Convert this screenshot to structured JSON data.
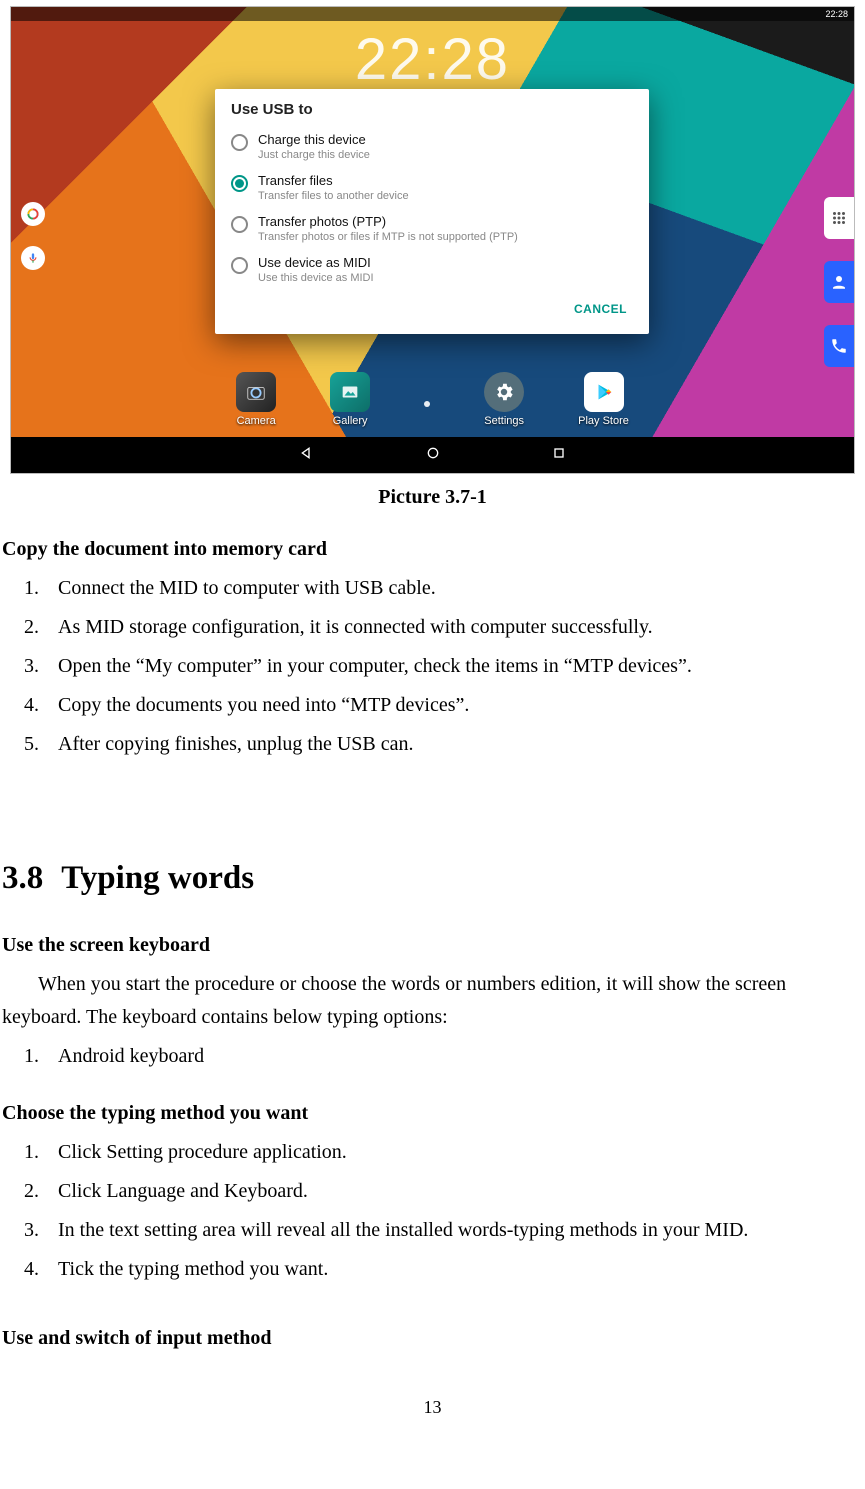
{
  "screenshot": {
    "status_time": "22:28",
    "clock_partial": "22:28",
    "dialog": {
      "title": "Use USB to",
      "options": [
        {
          "label": "Charge this device",
          "sub": "Just charge this device",
          "selected": false
        },
        {
          "label": "Transfer files",
          "sub": "Transfer files to another device",
          "selected": true
        },
        {
          "label": "Transfer photos (PTP)",
          "sub": "Transfer photos or files if MTP is not supported (PTP)",
          "selected": false
        },
        {
          "label": "Use device as MIDI",
          "sub": "Use this device as MIDI",
          "selected": false
        }
      ],
      "cancel": "CANCEL"
    },
    "apps": [
      "Camera",
      "Gallery",
      "Settings",
      "Play Store"
    ]
  },
  "caption": "Picture 3.7-1",
  "copy_heading": "Copy the document into memory card",
  "copy_steps": [
    "Connect the MID to computer with USB cable.",
    "As MID storage configuration, it is connected with computer successfully.",
    "Open the “My computer” in your computer, check the items in “MTP devices”.",
    "Copy the documents you need into “MTP devices”.",
    "After copying finishes, unplug the USB can."
  ],
  "section": {
    "num": "3.8",
    "title": "Typing words"
  },
  "use_kb_heading": "Use the screen keyboard",
  "use_kb_para": "When you start the procedure or choose the words or numbers edition, it will show the screen keyboard. The keyboard contains below typing options:",
  "kb_options": [
    "Android keyboard"
  ],
  "choose_heading": "Choose the typing method you want",
  "choose_steps": [
    "Click Setting procedure application.",
    "Click Language and Keyboard.",
    "In the text setting area will reveal all the installed words-typing methods in your MID.",
    "Tick the typing method you want."
  ],
  "switch_heading": "Use and switch of input method",
  "page_number": "13"
}
